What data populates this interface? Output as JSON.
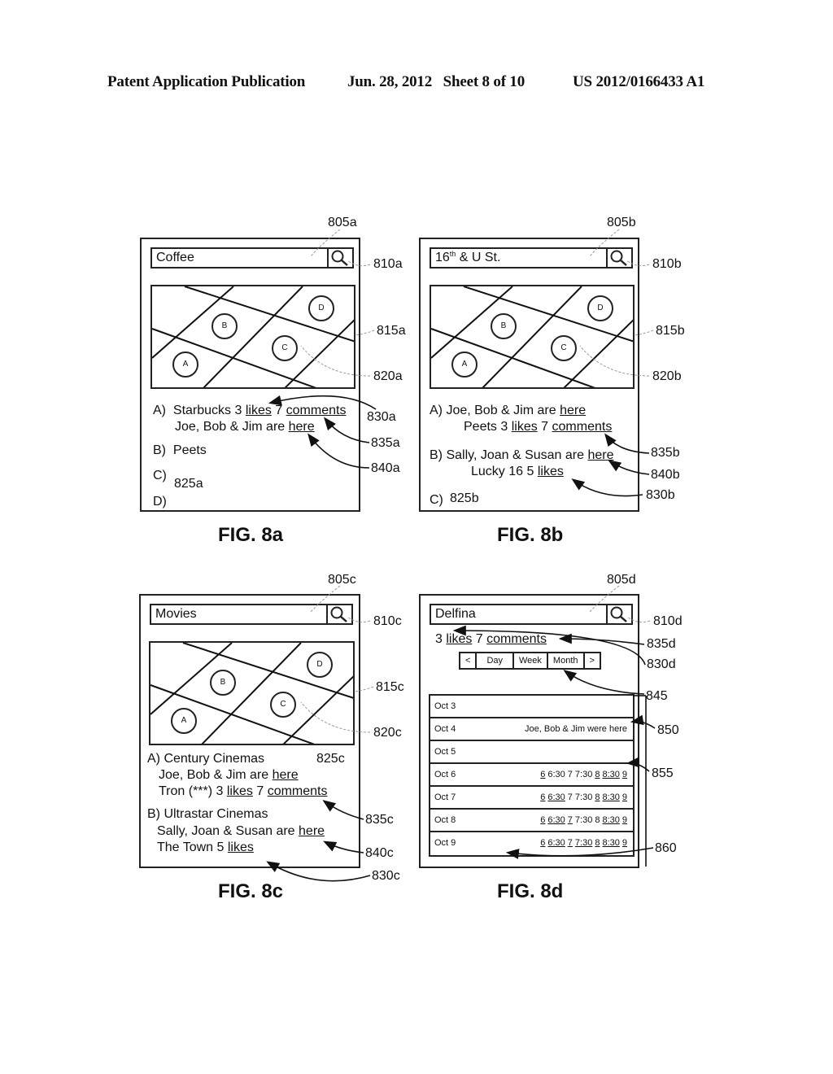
{
  "header": {
    "publication": "Patent Application Publication",
    "date_sheet": "Jun. 28, 2012   Sheet 8 of 10",
    "patent_number": "US 2012/0166433 A1"
  },
  "figures": {
    "a": {
      "caption": "FIG. 8a",
      "search_value": "Coffee",
      "markers": [
        "A",
        "B",
        "C",
        "D"
      ],
      "list": {
        "a_label": "A)",
        "a_name": "Starbucks 3 ",
        "a_likes": "likes",
        "a_mid": " 7 ",
        "a_comments": "comments",
        "a_line2": "Joe, Bob & Jim are ",
        "a_here": "here",
        "b_label": "B)",
        "b_name": "Peets",
        "c_label": "C)",
        "d_label": "D)"
      },
      "refs": {
        "screen": "805a",
        "search": "810a",
        "map": "815a",
        "marker": "820a",
        "list": "825a",
        "likes": "830a",
        "comments": "835a",
        "here": "840a"
      }
    },
    "b": {
      "caption": "FIG. 8b",
      "search_value_main": "16",
      "search_value_sup": "th",
      "search_value_rest": " & U St.",
      "markers": [
        "A",
        "B",
        "C",
        "D"
      ],
      "list": {
        "a_line1": "A) Joe, Bob & Jim are ",
        "a_here": "here",
        "a_line2": "Peets 3 ",
        "a_likes": "likes",
        "a_mid": " 7 ",
        "a_comments": "comments",
        "b_line1": "B) Sally, Joan & Susan are ",
        "b_here": "here",
        "b_line2": "Lucky 16 5 ",
        "b_likes": "likes",
        "c_label": "C)"
      },
      "refs": {
        "screen": "805b",
        "search": "810b",
        "map": "815b",
        "marker": "820b",
        "list": "825b",
        "likes": "830b",
        "comments": "835b",
        "here": "840b"
      }
    },
    "c": {
      "caption": "FIG. 8c",
      "search_value": "Movies",
      "markers": [
        "A",
        "B",
        "C",
        "D"
      ],
      "list": {
        "a_line1": "A) Century Cinemas",
        "a_line2": "Joe, Bob & Jim are ",
        "a_here": "here",
        "a_line3": "Tron (***) 3 ",
        "a_likes": "likes",
        "a_mid": " 7 ",
        "a_comments": "comments",
        "b_line1": "B) Ultrastar Cinemas",
        "b_line2": "Sally, Joan & Susan are ",
        "b_here": "here",
        "b_line3": "The Town 5 ",
        "b_likes": "likes"
      },
      "refs": {
        "screen": "805c",
        "search": "810c",
        "map": "815c",
        "marker": "820c",
        "list": "825c",
        "likes": "830c",
        "comments": "835c",
        "here": "840c"
      }
    },
    "d": {
      "caption": "FIG. 8d",
      "search_value": "Delfina",
      "stats": {
        "likes_count": "3 ",
        "likes": "likes",
        "mid": " 7 ",
        "comments": "comments"
      },
      "nav": [
        "<",
        "Day",
        "Week",
        "Month",
        ">"
      ],
      "calendar": [
        {
          "date": "Oct 3",
          "content": []
        },
        {
          "date": "Oct 4",
          "note": "Joe, Bob & Jim were here"
        },
        {
          "date": "Oct 5",
          "content": []
        },
        {
          "date": "Oct 6",
          "times": [
            {
              "t": "6",
              "link": true
            },
            {
              "t": "6:30",
              "link": false
            },
            {
              "t": "7",
              "link": false
            },
            {
              "t": "7:30",
              "link": false
            },
            {
              "t": "8",
              "link": true
            },
            {
              "t": "8:30",
              "link": true
            },
            {
              "t": "9",
              "link": true
            }
          ]
        },
        {
          "date": "Oct 7",
          "times": [
            {
              "t": "6",
              "link": true
            },
            {
              "t": "6:30",
              "link": true
            },
            {
              "t": "7",
              "link": false
            },
            {
              "t": "7:30",
              "link": false
            },
            {
              "t": "8",
              "link": true
            },
            {
              "t": "8:30",
              "link": true
            },
            {
              "t": "9",
              "link": true
            }
          ]
        },
        {
          "date": "Oct 8",
          "times": [
            {
              "t": "6",
              "link": true
            },
            {
              "t": "6:30",
              "link": true
            },
            {
              "t": "7",
              "link": true
            },
            {
              "t": "7:30",
              "link": false
            },
            {
              "t": "8",
              "link": false
            },
            {
              "t": "8:30",
              "link": true
            },
            {
              "t": "9",
              "link": true
            }
          ]
        },
        {
          "date": "Oct 9",
          "times": [
            {
              "t": "6",
              "link": true
            },
            {
              "t": "6:30",
              "link": true
            },
            {
              "t": "7",
              "link": true
            },
            {
              "t": "7:30",
              "link": true
            },
            {
              "t": "8",
              "link": true
            },
            {
              "t": "8:30",
              "link": true
            },
            {
              "t": "9",
              "link": true
            }
          ]
        }
      ],
      "refs": {
        "screen": "805d",
        "search": "810d",
        "comments": "835d",
        "likes": "830d",
        "nav": "845",
        "note_row": "850",
        "times_row": "855",
        "calendar": "860"
      }
    }
  }
}
